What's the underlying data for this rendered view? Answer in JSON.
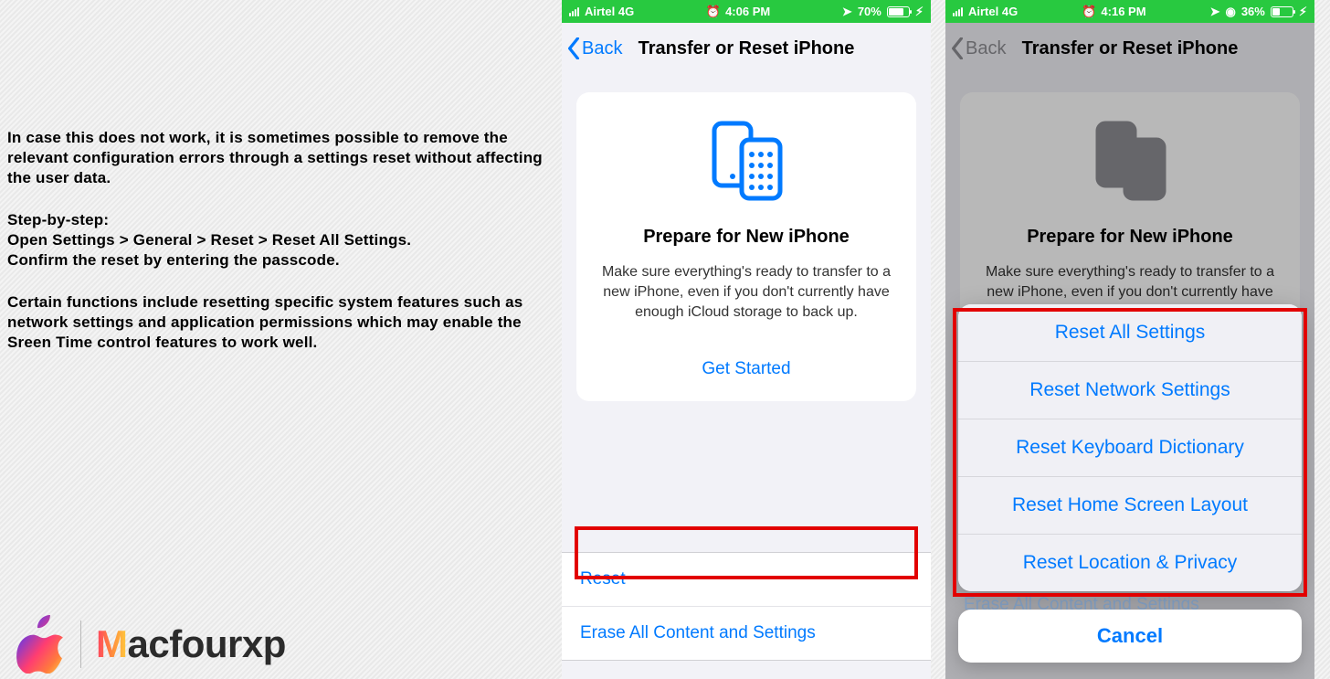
{
  "article": {
    "p1": "In case this does not work, it is sometimes possible to remove the relevant configuration errors through a settings reset without affecting the user data.",
    "p2": "Step-by-step:\nOpen Settings > General > Reset > Reset All Settings.\nConfirm the reset by entering the passcode.",
    "p3": "Certain functions include resetting specific system features such as network settings and application permissions which may enable the Sreen Time control features to work well."
  },
  "logo": {
    "word_rest": "acfourxp"
  },
  "shot_left": {
    "status": {
      "carrier": "Airtel  4G",
      "time": "4:06 PM",
      "battery_pct": "70%",
      "battery_fill": 70
    },
    "nav": {
      "back": "Back",
      "title": "Transfer or Reset iPhone"
    },
    "card": {
      "heading": "Prepare for New iPhone",
      "desc": "Make sure everything's ready to transfer to a new iPhone, even if you don't currently have enough iCloud storage to back up.",
      "cta": "Get Started"
    },
    "rows": {
      "reset": "Reset",
      "erase": "Erase All Content and Settings"
    }
  },
  "shot_right": {
    "status": {
      "carrier": "Airtel  4G",
      "time": "4:16 PM",
      "battery_pct": "36%",
      "battery_fill": 36
    },
    "nav": {
      "back": "Back",
      "title": "Transfer or Reset iPhone"
    },
    "card": {
      "heading": "Prepare for New iPhone",
      "desc": "Make sure everything's ready to transfer to a new iPhone, even if you don't currently have enough iCloud storage to back up."
    },
    "ghost_row": "Erase All Content and Settings",
    "sheet": {
      "options": [
        "Reset All Settings",
        "Reset Network Settings",
        "Reset Keyboard Dictionary",
        "Reset Home Screen Layout",
        "Reset Location & Privacy"
      ]
    },
    "cancel": "Cancel"
  }
}
